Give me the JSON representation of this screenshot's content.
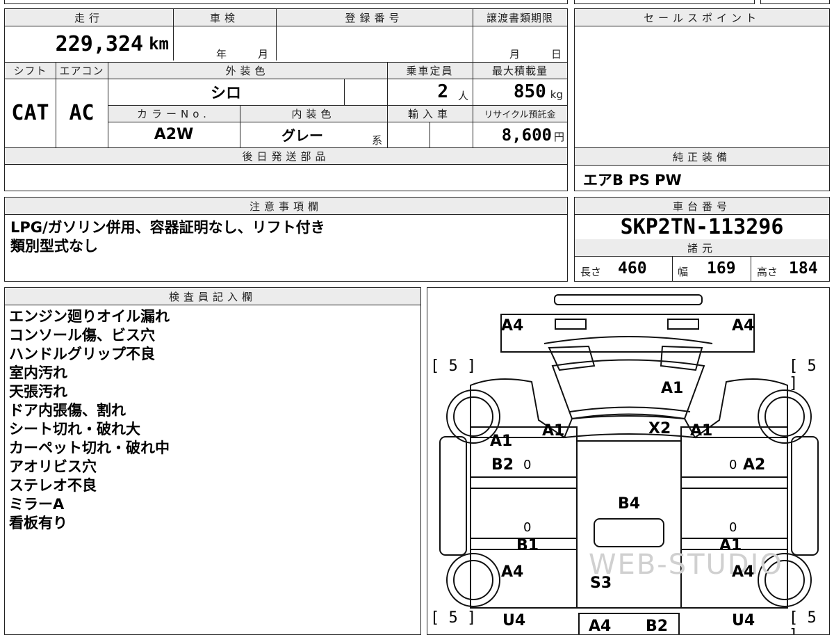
{
  "mileage": {
    "label": "走行",
    "value": "229,324",
    "unit": "km"
  },
  "inspection": {
    "label": "車検",
    "year_unit": "年",
    "month_unit": "月"
  },
  "registration_number": {
    "label": "登録番号"
  },
  "transfer_deadline": {
    "label": "譲渡書類期限",
    "month_unit": "月",
    "day_unit": "日"
  },
  "shift": {
    "label": "シフト",
    "value": "CAT"
  },
  "aircon": {
    "label": "エアコン",
    "value": "AC"
  },
  "exterior_color": {
    "label": "外装色",
    "value": "シロ"
  },
  "capacity": {
    "label": "乗車定員",
    "value": "2",
    "unit": "人"
  },
  "max_load": {
    "label": "最大積載量",
    "value": "850",
    "unit": "kg"
  },
  "color_no": {
    "label": "カラーNo.",
    "value": "A2W"
  },
  "interior_color": {
    "label": "内装色",
    "value": "グレー",
    "suffix": "系"
  },
  "import": {
    "label": "輸入車"
  },
  "recycle_fee": {
    "label": "リサイクル預託金",
    "value": "8,600",
    "unit": "円"
  },
  "later_parts": {
    "label": "後日発送部品"
  },
  "sales_point": {
    "label": "セールスポイント"
  },
  "genuine_equipment": {
    "label": "純正装備",
    "value": "エアB PS PW"
  },
  "notes": {
    "label": "注意事項欄",
    "text": "LPG/ガソリン併用、容器証明なし、リフト付き\n類別型式なし"
  },
  "chassis_number": {
    "label": "車台番号",
    "value": "SKP2TN-113296"
  },
  "specs": {
    "label": "諸元",
    "length_label": "長さ",
    "length": "460",
    "width_label": "幅",
    "width": "169",
    "height_label": "高さ",
    "height": "184"
  },
  "inspector": {
    "label": "検査員記入欄",
    "lines": [
      "エンジン廻りオイル漏れ",
      "コンソール傷、ビス穴",
      "ハンドルグリップ不良",
      "室内汚れ",
      "天張汚れ",
      "ドア内張傷、割れ",
      "シート切れ・破れ大",
      "カーペット切れ・破れ中",
      "アオリビス穴",
      "ステレオ不良",
      "ミラーA",
      "看板有り"
    ]
  },
  "diagram": {
    "watermark": "WEB-STUDIO",
    "codes": {
      "front_left_a4": "A4",
      "front_right_a4": "A4",
      "bracket_fl": "[ 5 ]",
      "bracket_fr": "[ 5 ]",
      "bracket_rl": "[ 5 ]",
      "bracket_rr": "[ 5 ]",
      "windshield_a1": "A1",
      "cowl_left_a1": "A1",
      "roof_x2": "X2",
      "cowl_right_a1": "A1",
      "left_door_a1": "A1",
      "left_door_b2": "B2",
      "right_door_a2": "A2",
      "floor_b4": "B4",
      "left_rear_b1": "B1",
      "right_rear_a1": "A1",
      "left_fender_a4": "A4",
      "right_fender_a4": "A4",
      "bed_s3": "S3",
      "left_u4": "U4",
      "right_u4": "U4",
      "rear_a4": "A4",
      "rear_b2": "B2",
      "zero_1": "0",
      "zero_2": "0",
      "zero_3": "0",
      "zero_4": "0"
    }
  }
}
